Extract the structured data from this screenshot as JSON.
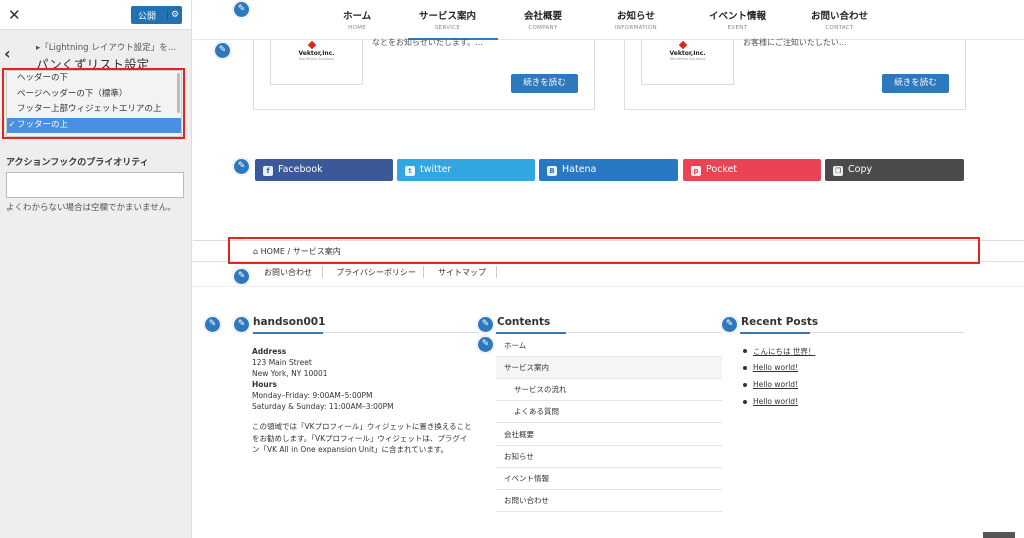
{
  "panel": {
    "close_label": "✕",
    "publish_label": "公開",
    "publish_gear": "⚙",
    "back_label": "‹",
    "breadcrumb": "▸「Lightning レイアウト設定」を…",
    "section_title": "パンくずリスト設定",
    "dropdown_options": [
      "ヘッダーの下",
      "ページヘッダーの下（標準）",
      "フッター上部ウィジェットエリアの上",
      "フッターの上"
    ],
    "dropdown_selected_check": "✓",
    "priority_label": "アクションフックのプライオリティ",
    "priority_value": "",
    "priority_help": "よくわからない場合は空欄でかまいません。"
  },
  "nav": [
    {
      "jp": "ホーム",
      "en": "HOME"
    },
    {
      "jp": "サービス案内",
      "en": "SERVICE"
    },
    {
      "jp": "会社概要",
      "en": "COMPANY"
    },
    {
      "jp": "お知らせ",
      "en": "INFORMATION"
    },
    {
      "jp": "イベント情報",
      "en": "EVENT"
    },
    {
      "jp": "お問い合わせ",
      "en": "CONTACT"
    }
  ],
  "cards": [
    {
      "logo": "Vektor,Inc.",
      "logo_sub": "WordPress Solutions",
      "snippet": "なとをお知らせいたします。…",
      "button": "続きを読む"
    },
    {
      "logo": "Vektor,Inc.",
      "logo_sub": "WordPress Solutions",
      "snippet": "お客様にご注知いたしたい…",
      "button": "続きを読む"
    }
  ],
  "pencil_glyph": "✎",
  "share": [
    {
      "label": "Facebook",
      "icon": "f",
      "color": "#3b5998"
    },
    {
      "label": "twitter",
      "icon": "t",
      "color": "#31a6e0"
    },
    {
      "label": "Hatena",
      "icon": "B",
      "color": "#2878c4"
    },
    {
      "label": "Pocket",
      "icon": "p",
      "color": "#ea4356"
    },
    {
      "label": "Copy",
      "icon": "❐",
      "color": "#4a4a4a"
    }
  ],
  "breadcrumb": {
    "home_icon": "⌂",
    "home": "HOME",
    "sep": "/",
    "current": "サービス案内"
  },
  "footer_nav": [
    "お問い合わせ",
    "プライバシーポリシー",
    "サイトマップ"
  ],
  "widget1": {
    "title": "handson001",
    "address_label": "Address",
    "address_line1": "123 Main Street",
    "address_line2": "New York, NY 10001",
    "hours_label": "Hours",
    "hours_line1": "Monday–Friday: 9:00AM–5:00PM",
    "hours_line2": "Saturday & Sunday: 11:00AM–3:00PM",
    "description": "この領域では「VKプロフィール」ウィジェットに置き換えることをお勧めします。「VKプロフィール」ウィジェットは、プラグイン「VK All in One expansion Unit」に含まれています。"
  },
  "widget2": {
    "title": "Contents",
    "items": [
      "ホーム",
      "サービス案内",
      "サービスの流れ",
      "よくある質問",
      "会社概要",
      "お知らせ",
      "イベント情報",
      "お問い合わせ"
    ]
  },
  "widget3": {
    "title": "Recent Posts",
    "posts": [
      "こんにちは 世界！",
      "Hello world!",
      "Hello world!",
      "Hello world!"
    ]
  },
  "colors": {
    "accent": "#2e78bd",
    "highlight": "#e3261b"
  }
}
